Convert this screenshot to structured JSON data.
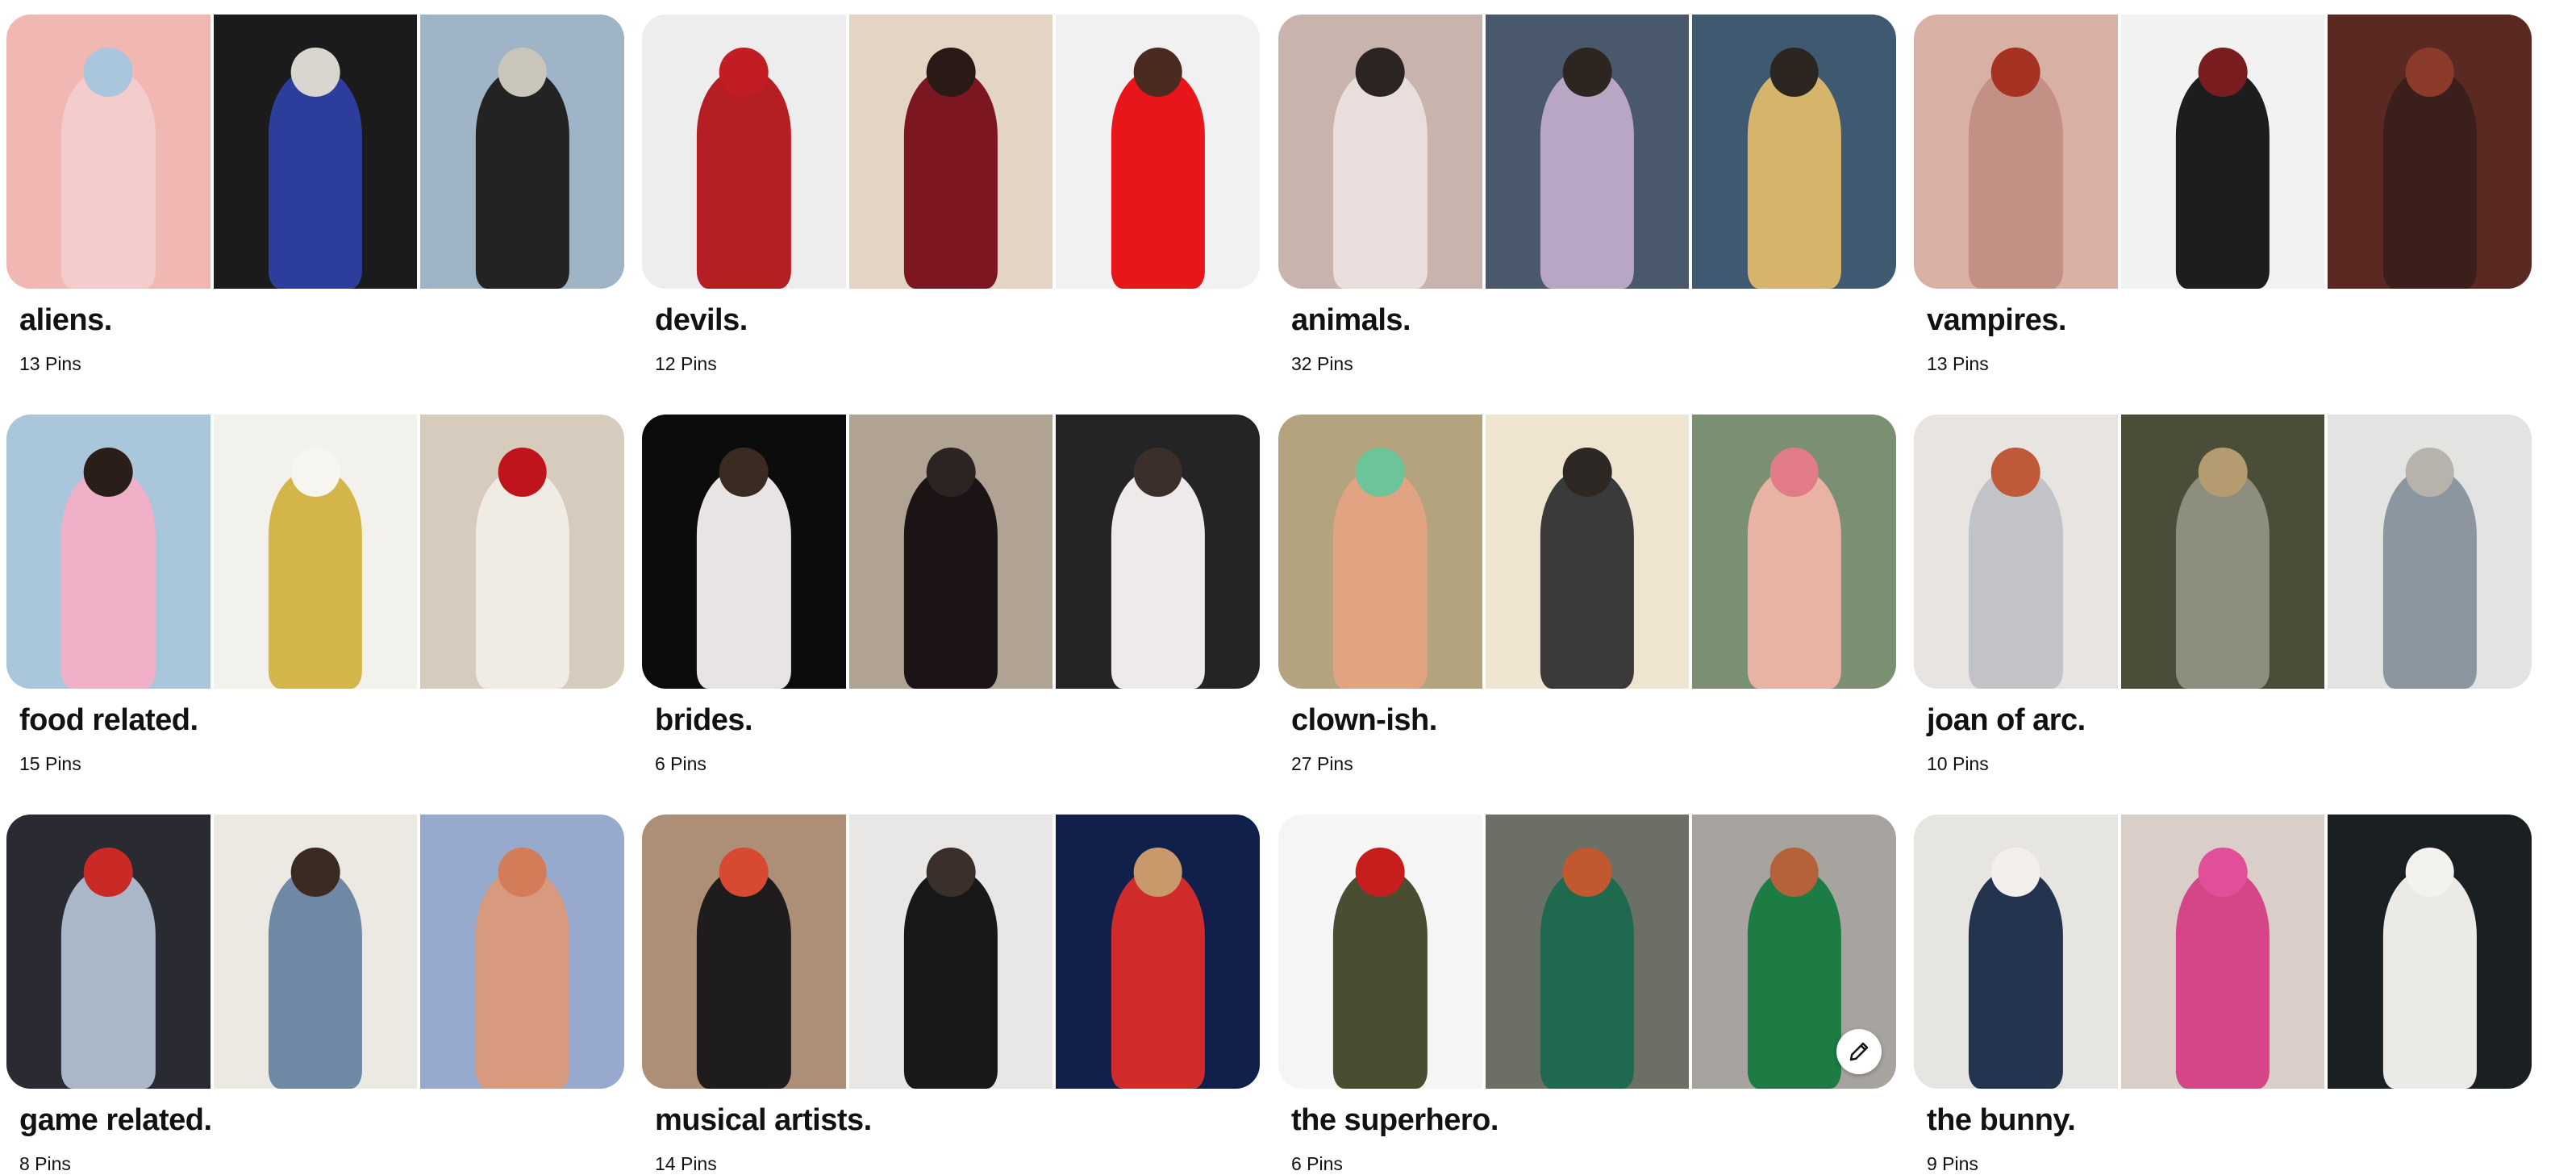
{
  "boards": [
    {
      "title": "aliens.",
      "pins": "13 Pins",
      "tiles": [
        {
          "bg": "#f1b8b3",
          "fig": "#f4cccc",
          "head": "#a9c6dd"
        },
        {
          "bg": "#1b1b1b",
          "fig": "#2c3d9b",
          "head": "#d9d6cf"
        },
        {
          "bg": "#9fb4c6",
          "fig": "#232323",
          "head": "#c9c5bb"
        }
      ]
    },
    {
      "title": "devils.",
      "pins": "12 Pins",
      "tiles": [
        {
          "bg": "#ededed",
          "fig": "#b51f24",
          "head": "#c31d24"
        },
        {
          "bg": "#e3d4c4",
          "fig": "#7c1620",
          "head": "#2a1a15"
        },
        {
          "bg": "#f1f1f1",
          "fig": "#e8161a",
          "head": "#4b2a20"
        }
      ]
    },
    {
      "title": "animals.",
      "pins": "32 Pins",
      "tiles": [
        {
          "bg": "#c9b4ad",
          "fig": "#e9dedc",
          "head": "#2b2422"
        },
        {
          "bg": "#49586a",
          "fig": "#b8a6c4",
          "head": "#2d2620"
        },
        {
          "bg": "#3f5a70",
          "fig": "#d6b46c",
          "head": "#2d2620"
        }
      ]
    },
    {
      "title": "vampires.",
      "pins": "13 Pins",
      "tiles": [
        {
          "bg": "#d9b1a4",
          "fig": "#c29085",
          "head": "#a53222"
        },
        {
          "bg": "#f2f2f2",
          "fig": "#1d1d1d",
          "head": "#7a1d20"
        },
        {
          "bg": "#5a2a22",
          "fig": "#3a1f1a",
          "head": "#8c3b2b"
        }
      ]
    },
    {
      "title": "food related.",
      "pins": "15 Pins",
      "tiles": [
        {
          "bg": "#aac6da",
          "fig": "#f0b0c8",
          "head": "#2a1e18"
        },
        {
          "bg": "#f3f1ec",
          "fig": "#d4b54a",
          "head": "#f7f5f0"
        },
        {
          "bg": "#d6cbbd",
          "fig": "#f1ece3",
          "head": "#c0141c"
        }
      ]
    },
    {
      "title": "brides.",
      "pins": "6 Pins",
      "tiles": [
        {
          "bg": "#0c0c0c",
          "fig": "#e8e4e3",
          "head": "#3a2a22"
        },
        {
          "bg": "#b1a394",
          "fig": "#1c1414",
          "head": "#2b2422"
        },
        {
          "bg": "#242424",
          "fig": "#eeeaea",
          "head": "#3a2f2a"
        }
      ]
    },
    {
      "title": "clown-ish.",
      "pins": "27 Pins",
      "tiles": [
        {
          "bg": "#b4a37f",
          "fig": "#e2a383",
          "head": "#6cc598"
        },
        {
          "bg": "#efe4cf",
          "fig": "#3a3a3a",
          "head": "#2d2824"
        },
        {
          "bg": "#7b8f73",
          "fig": "#e8b3a4",
          "head": "#e07b87"
        }
      ]
    },
    {
      "title": "joan of arc.",
      "pins": "10 Pins",
      "tiles": [
        {
          "bg": "#e7e4e2",
          "fig": "#c2c3c6",
          "head": "#c0583a"
        },
        {
          "bg": "#4a4d38",
          "fig": "#8e8e7f",
          "head": "#b49c70"
        },
        {
          "bg": "#e3e3e1",
          "fig": "#8b96a1",
          "head": "#b8b3aa"
        }
      ]
    },
    {
      "title": "game related.",
      "pins": "8 Pins",
      "tiles": [
        {
          "bg": "#2a2a32",
          "fig": "#a9b7c9",
          "head": "#c92a25"
        },
        {
          "bg": "#ece8e2",
          "fig": "#6f88a5",
          "head": "#3a2a22"
        },
        {
          "bg": "#97aacd",
          "fig": "#d89a7f",
          "head": "#d27d58"
        }
      ]
    },
    {
      "title": "musical artists.",
      "pins": "14 Pins",
      "tiles": [
        {
          "bg": "#ad8f77",
          "fig": "#1e1c1c",
          "head": "#d74a31"
        },
        {
          "bg": "#e8e7e5",
          "fig": "#181818",
          "head": "#3a2f2a"
        },
        {
          "bg": "#10204b",
          "fig": "#d02c2c",
          "head": "#c89a6b"
        }
      ]
    },
    {
      "title": "the superhero.",
      "pins": "6 Pins",
      "tiles": [
        {
          "bg": "#f5f5f5",
          "fig": "#4b4d32",
          "head": "#c61d1d"
        },
        {
          "bg": "#6b6f66",
          "fig": "#1f6a4f",
          "head": "#c2582f"
        },
        {
          "bg": "#a7a39f",
          "fig": "#1d7b44",
          "head": "#b5623b"
        }
      ]
    },
    {
      "title": "the bunny.",
      "pins": "9 Pins",
      "tiles": [
        {
          "bg": "#e6e5e2",
          "fig": "#24344f",
          "head": "#f3efec"
        },
        {
          "bg": "#d9cfc8",
          "fig": "#d54688",
          "head": "#e14f9a"
        },
        {
          "bg": "#1a1f22",
          "fig": "#eceae6",
          "head": "#f4f2ef"
        }
      ]
    }
  ],
  "edit_icon": "pencil-icon"
}
